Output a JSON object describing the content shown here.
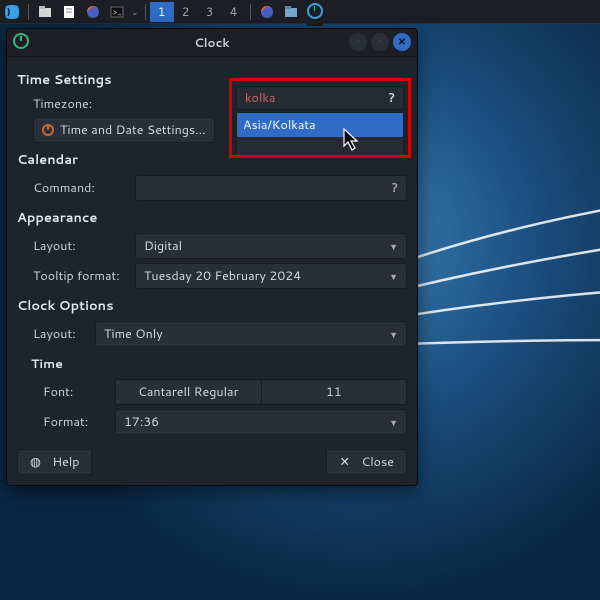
{
  "taskbar": {
    "workspaces": [
      "1",
      "2",
      "3",
      "4"
    ]
  },
  "window": {
    "title": "Clock",
    "sections": {
      "time_settings": {
        "header": "Time Settings",
        "timezone_label": "Timezone:",
        "timezone_value": "kolka",
        "timezone_suggest": "Asia/Kolkata",
        "time_date_btn": "Time and Date Settings..."
      },
      "calendar": {
        "header": "Calendar",
        "command_label": "Command:"
      },
      "appearance": {
        "header": "Appearance",
        "layout_label": "Layout:",
        "layout_value": "Digital",
        "tooltip_label": "Tooltip format:",
        "tooltip_value": "Tuesday 20 February 2024"
      },
      "clock_options": {
        "header": "Clock Options",
        "layout_label": "Layout:",
        "layout_value": "Time Only",
        "time_header": "Time",
        "font_label": "Font:",
        "font_value": "Cantarell Regular",
        "font_size": "11",
        "format_label": "Format:",
        "format_value": "17:36"
      }
    },
    "footer": {
      "help": "Help",
      "close": "Close"
    }
  }
}
